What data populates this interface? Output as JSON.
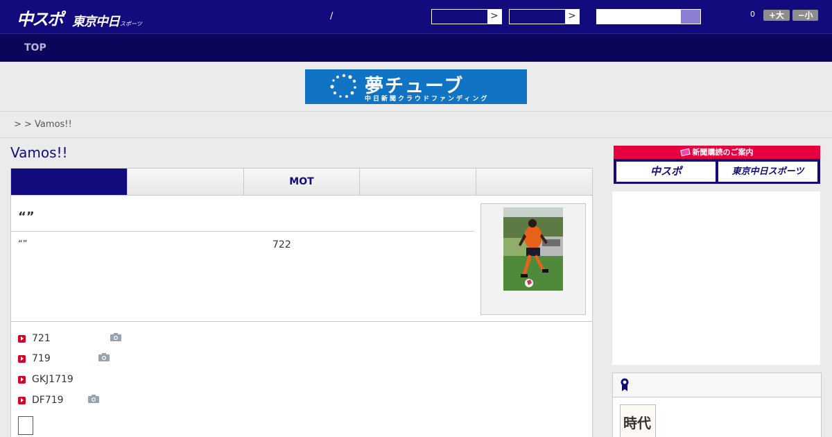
{
  "header": {
    "logo_primary": "中スポ",
    "logo_secondary": "東京中日",
    "logo_tertiary": "スポーツ",
    "separator": "/",
    "select1_arrow": ">",
    "select2_arrow": ">",
    "search_placeholder": "",
    "font_size_count": "0",
    "font_larger": "+大",
    "font_smaller": "−小"
  },
  "nav": {
    "top_label": "TOP"
  },
  "banner": {
    "title": "夢チューブ",
    "subtitle": "中日新聞クラウドファンディング"
  },
  "breadcrumb": {
    "text": ">  > Vamos!!"
  },
  "page": {
    "title": "Vamos!!"
  },
  "tabs": [
    {
      "label": "",
      "active": true
    },
    {
      "label": ""
    },
    {
      "label": "MOT"
    },
    {
      "label": ""
    },
    {
      "label": ""
    }
  ],
  "article": {
    "headline": "“”",
    "lead": "“”",
    "lead_number": "722"
  },
  "related": [
    {
      "label": "721",
      "has_photo": true
    },
    {
      "label": "719",
      "has_photo": true
    },
    {
      "label": "GKJ1719",
      "has_photo": false
    },
    {
      "label": "DF719",
      "has_photo": true
    }
  ],
  "sidebar": {
    "subscribe_header": "新聞購読のご案内",
    "subscribe_btn1": "中スポ",
    "subscribe_btn2": "東京中日スポーツ",
    "ranking_thumb_text": "時代"
  },
  "colors": {
    "brand_navy": "#120b7e",
    "nav_dark": "#0c065a",
    "accent_red": "#e6003d",
    "banner_blue": "#1173c4"
  }
}
